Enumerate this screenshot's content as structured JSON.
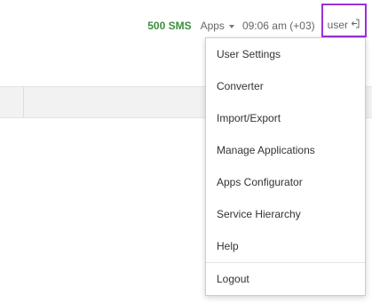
{
  "header": {
    "sms_label": "500 SMS",
    "apps_label": "Apps",
    "time_label": "09:06 am (+03)",
    "user_label": "user",
    "colors": {
      "sms": "#3c8f3c",
      "highlight": "#9b30d9"
    }
  },
  "user_menu": {
    "items": [
      {
        "label": "User Settings"
      },
      {
        "label": "Converter"
      },
      {
        "label": "Import/Export"
      },
      {
        "label": "Manage Applications"
      },
      {
        "label": "Apps Configurator"
      },
      {
        "label": "Service Hierarchy"
      },
      {
        "label": "Help"
      }
    ],
    "logout_label": "Logout"
  }
}
